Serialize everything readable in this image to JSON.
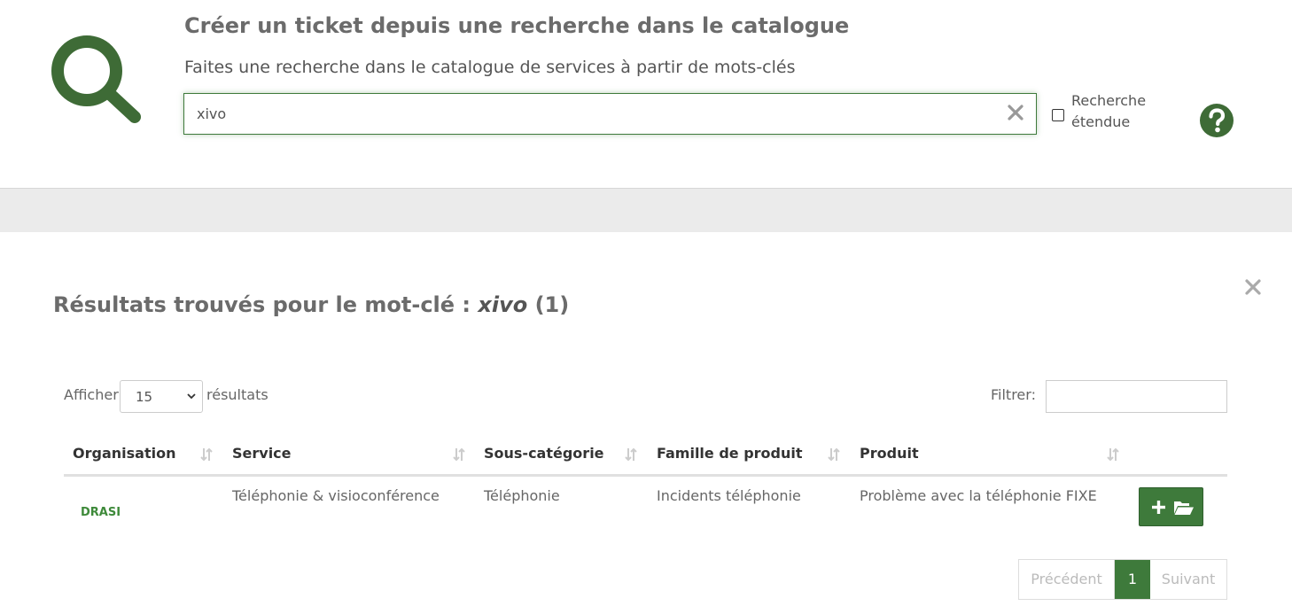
{
  "header": {
    "logo_icon": "search-icon",
    "title": "Créer un ticket depuis une recherche dans le catalogue",
    "subtitle": "Faites une recherche dans le catalogue de services à partir de mots-clés",
    "search_value": "xivo",
    "clear_icon": "close-icon",
    "extended_search_label": "Recherche étendue",
    "extended_search_checked": false,
    "help_icon": "question-circle-icon"
  },
  "results": {
    "title_prefix": "Résultats trouvés pour le mot-clé :",
    "keyword": "xivo",
    "count_text": "(1)",
    "show_label": "Afficher",
    "page_size": "15",
    "results_label": "résultats",
    "filter_label": "Filtrer:",
    "filter_value": "",
    "columns": [
      "Organisation",
      "Service",
      "Sous-catégorie",
      "Famille de produit",
      "Produit"
    ],
    "rows": [
      {
        "organisation": "DRASI",
        "service": "Téléphonie & visioconférence",
        "sous_categorie": "Téléphonie",
        "famille": "Incidents téléphonie",
        "produit": "Problème avec la téléphonie FIXE"
      }
    ],
    "pagination": {
      "previous": "Précédent",
      "current": "1",
      "next": "Suivant"
    }
  },
  "colors": {
    "primary_green": "#3e7a3b",
    "org_green": "#3e8a3a",
    "separator_gray": "#ebebeb"
  }
}
